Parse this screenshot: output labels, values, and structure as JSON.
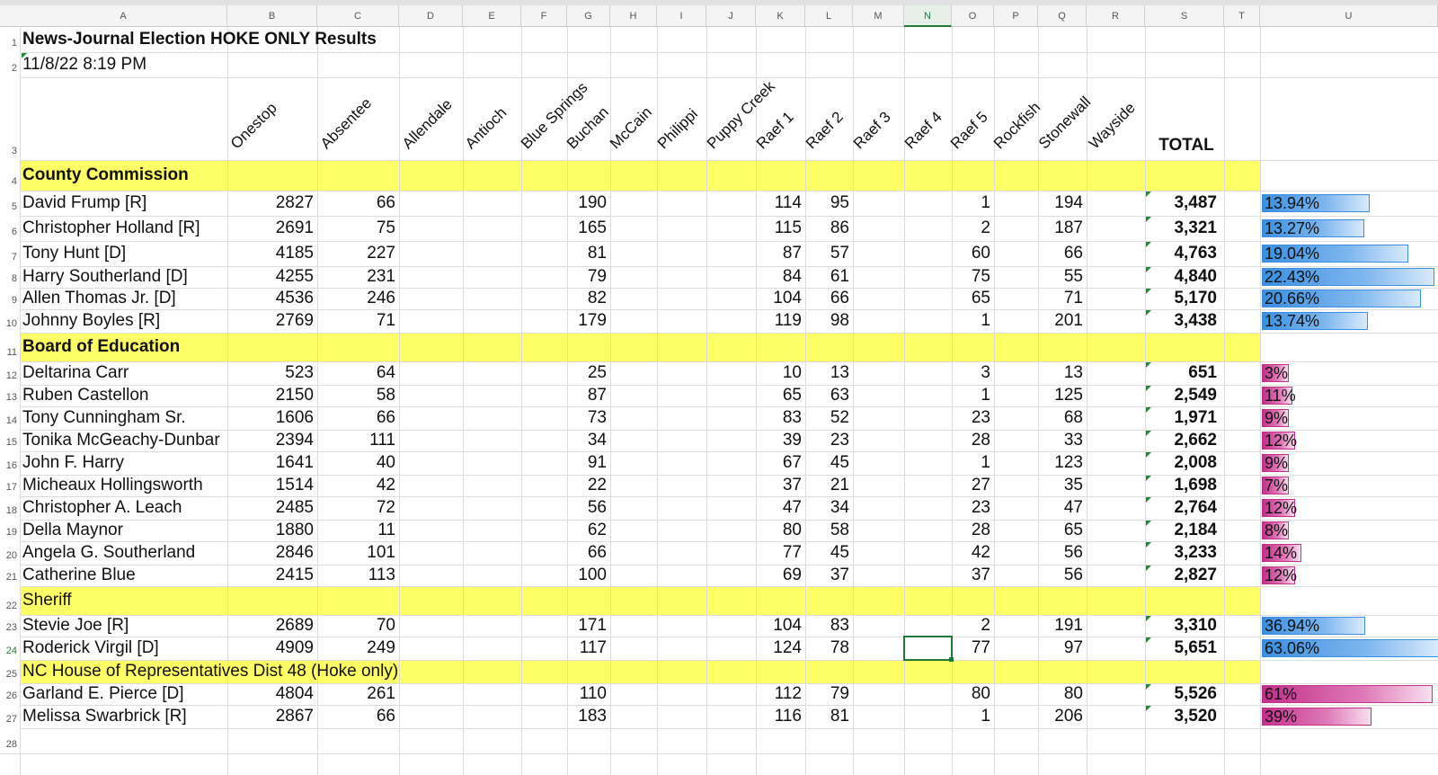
{
  "columns": [
    "A",
    "B",
    "C",
    "D",
    "E",
    "F",
    "G",
    "H",
    "I",
    "J",
    "K",
    "L",
    "M",
    "N",
    "O",
    "P",
    "Q",
    "R",
    "S",
    "T",
    "U"
  ],
  "selected_column": "N",
  "selected_row": "24",
  "title": "News-Journal Election HOKE ONLY Results",
  "timestamp": "11/8/22 8:19 PM",
  "precinct_headers": [
    "Onestop",
    "Absentee",
    "Allendale",
    "Antioch",
    "Blue Springs",
    "Buchan",
    "McCain",
    "Philippi",
    "Puppy Creek",
    "Raef 1",
    "Raef 2",
    "Raef 3",
    "Raef 4",
    "Raef 5",
    "Rockfish",
    "Stonewall",
    "Wayside"
  ],
  "total_header": "TOTAL",
  "sections": [
    {
      "row": "4",
      "title": "County Commission",
      "bold": true,
      "bar_color": "blue",
      "candidates": [
        {
          "row": "5",
          "name": "David Frump [R]",
          "onestop": "2827",
          "absentee": "66",
          "buchan": "190",
          "raef1": "114",
          "raef2": "95",
          "raef5": "1",
          "stonewall": "194",
          "total": "3,487",
          "pct_label": "13.94%",
          "pct": 13.94
        },
        {
          "row": "6",
          "name": "Christopher Holland [R]",
          "onestop": "2691",
          "absentee": "75",
          "buchan": "165",
          "raef1": "115",
          "raef2": "86",
          "raef5": "2",
          "stonewall": "187",
          "total": "3,321",
          "pct_label": "13.27%",
          "pct": 13.27
        },
        {
          "row": "7",
          "name": "Tony Hunt [D]",
          "onestop": "4185",
          "absentee": "227",
          "buchan": "81",
          "raef1": "87",
          "raef2": "57",
          "raef5": "60",
          "stonewall": "66",
          "total": "4,763",
          "pct_label": "19.04%",
          "pct": 19.04
        },
        {
          "row": "8",
          "name": "Harry Southerland [D]",
          "onestop": "4255",
          "absentee": "231",
          "buchan": "79",
          "raef1": "84",
          "raef2": "61",
          "raef5": "75",
          "stonewall": "55",
          "total": "4,840",
          "pct_label": "22.43%",
          "pct": 22.43
        },
        {
          "row": "9",
          "name": "Allen Thomas Jr. [D]",
          "onestop": "4536",
          "absentee": "246",
          "buchan": "82",
          "raef1": "104",
          "raef2": "66",
          "raef5": "65",
          "stonewall": "71",
          "total": "5,170",
          "pct_label": "20.66%",
          "pct": 20.66
        },
        {
          "row": "10",
          "name": "Johnny Boyles [R]",
          "onestop": "2769",
          "absentee": "71",
          "buchan": "179",
          "raef1": "119",
          "raef2": "98",
          "raef5": "1",
          "stonewall": "201",
          "total": "3,438",
          "pct_label": "13.74%",
          "pct": 13.74
        }
      ]
    },
    {
      "row": "11",
      "title": "Board of Education",
      "bold": true,
      "bar_color": "pink",
      "candidates": [
        {
          "row": "12",
          "name": "Deltarina Carr",
          "onestop": "523",
          "absentee": "64",
          "buchan": "25",
          "raef1": "10",
          "raef2": "13",
          "raef5": "3",
          "stonewall": "13",
          "total": "651",
          "pct_label": "3%",
          "pct": 3
        },
        {
          "row": "13",
          "name": "Ruben Castellon",
          "onestop": "2150",
          "absentee": "58",
          "buchan": "87",
          "raef1": "65",
          "raef2": "63",
          "raef5": "1",
          "stonewall": "125",
          "total": "2,549",
          "pct_label": "11%",
          "pct": 11
        },
        {
          "row": "14",
          "name": "Tony Cunningham Sr.",
          "onestop": "1606",
          "absentee": "66",
          "buchan": "73",
          "raef1": "83",
          "raef2": "52",
          "raef5": "23",
          "stonewall": "68",
          "total": "1,971",
          "pct_label": "9%",
          "pct": 9
        },
        {
          "row": "15",
          "name": "Tonika McGeachy-Dunbar",
          "onestop": "2394",
          "absentee": "111",
          "buchan": "34",
          "raef1": "39",
          "raef2": "23",
          "raef5": "28",
          "stonewall": "33",
          "total": "2,662",
          "pct_label": "12%",
          "pct": 12
        },
        {
          "row": "16",
          "name": "John F. Harry",
          "onestop": "1641",
          "absentee": "40",
          "buchan": "91",
          "raef1": "67",
          "raef2": "45",
          "raef5": "1",
          "stonewall": "123",
          "total": "2,008",
          "pct_label": "9%",
          "pct": 9
        },
        {
          "row": "17",
          "name": "Micheaux Hollingsworth",
          "onestop": "1514",
          "absentee": "42",
          "buchan": "22",
          "raef1": "37",
          "raef2": "21",
          "raef5": "27",
          "stonewall": "35",
          "total": "1,698",
          "pct_label": "7%",
          "pct": 7
        },
        {
          "row": "18",
          "name": "Christopher A. Leach",
          "onestop": "2485",
          "absentee": "72",
          "buchan": "56",
          "raef1": "47",
          "raef2": "34",
          "raef5": "23",
          "stonewall": "47",
          "total": "2,764",
          "pct_label": "12%",
          "pct": 12
        },
        {
          "row": "19",
          "name": "Della Maynor",
          "onestop": "1880",
          "absentee": "11",
          "buchan": "62",
          "raef1": "80",
          "raef2": "58",
          "raef5": "28",
          "stonewall": "65",
          "total": "2,184",
          "pct_label": "8%",
          "pct": 8
        },
        {
          "row": "20",
          "name": "Angela G. Southerland",
          "onestop": "2846",
          "absentee": "101",
          "buchan": "66",
          "raef1": "77",
          "raef2": "45",
          "raef5": "42",
          "stonewall": "56",
          "total": "3,233",
          "pct_label": "14%",
          "pct": 14
        },
        {
          "row": "21",
          "name": "Catherine Blue",
          "onestop": "2415",
          "absentee": "113",
          "buchan": "100",
          "raef1": "69",
          "raef2": "37",
          "raef5": "37",
          "stonewall": "56",
          "total": "2,827",
          "pct_label": "12%",
          "pct": 12
        }
      ]
    },
    {
      "row": "22",
      "title": "Sheriff",
      "bold": false,
      "bar_color": "blue",
      "candidates": [
        {
          "row": "23",
          "name": "Stevie Joe [R]",
          "onestop": "2689",
          "absentee": "70",
          "buchan": "171",
          "raef1": "104",
          "raef2": "83",
          "raef5": "2",
          "stonewall": "191",
          "total": "3,310",
          "pct_label": "36.94%",
          "pct": 36.94
        },
        {
          "row": "24",
          "name": "Roderick Virgil [D]",
          "onestop": "4909",
          "absentee": "249",
          "buchan": "117",
          "raef1": "124",
          "raef2": "78",
          "raef5": "77",
          "stonewall": "97",
          "total": "5,651",
          "pct_label": "63.06%",
          "pct": 63.06
        }
      ]
    },
    {
      "row": "25",
      "title": "NC House of Representatives Dist 48 (Hoke only)",
      "bold": false,
      "bar_color": "pink",
      "candidates": [
        {
          "row": "26",
          "name": "Garland E. Pierce [D]",
          "onestop": "4804",
          "absentee": "261",
          "buchan": "110",
          "raef1": "112",
          "raef2": "79",
          "raef5": "80",
          "stonewall": "80",
          "total": "5,526",
          "pct_label": "61%",
          "pct": 61
        },
        {
          "row": "27",
          "name": "Melissa Swarbrick [R]",
          "onestop": "2867",
          "absentee": "66",
          "buchan": "183",
          "raef1": "116",
          "raef2": "81",
          "raef5": "1",
          "stonewall": "206",
          "total": "3,520",
          "pct_label": "39%",
          "pct": 39
        }
      ]
    }
  ]
}
